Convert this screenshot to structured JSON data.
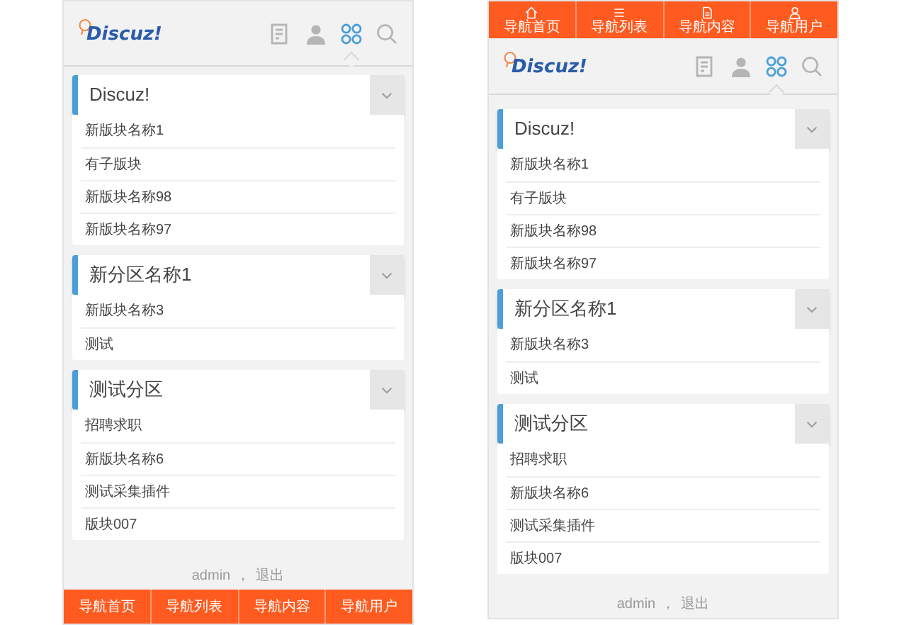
{
  "screens": [
    {
      "kind": "bottomnav",
      "logo": "Discuz!",
      "header_tabs": [
        {
          "selected": false
        },
        {
          "selected": false
        },
        {
          "selected": true
        },
        {
          "selected": false
        }
      ],
      "sections": [
        {
          "title": "Discuz!",
          "boards": [
            "新版块名称1",
            "有子版块",
            "新版块名称98",
            "新版块名称97"
          ]
        },
        {
          "title": "新分区名称1",
          "boards": [
            "新版块名称3",
            "测试"
          ]
        },
        {
          "title": "测试分区",
          "boards": [
            "招聘求职",
            "新版块名称6",
            "测试采集插件",
            "版块007"
          ]
        }
      ],
      "footer": {
        "user": "admin",
        "separator": "，",
        "logout": "退出"
      },
      "nav": [
        "导航首页",
        "导航列表",
        "导航内容",
        "导航用户"
      ]
    },
    {
      "kind": "topnav",
      "logo": "Discuz!",
      "header_tabs": [
        {
          "selected": false
        },
        {
          "selected": false
        },
        {
          "selected": true
        },
        {
          "selected": false
        }
      ],
      "sections": [
        {
          "title": "Discuz!",
          "boards": [
            "新版块名称1",
            "有子版块",
            "新版块名称98",
            "新版块名称97"
          ]
        },
        {
          "title": "新分区名称1",
          "boards": [
            "新版块名称3",
            "测试"
          ]
        },
        {
          "title": "测试分区",
          "boards": [
            "招聘求职",
            "新版块名称6",
            "测试采集插件",
            "版块007"
          ]
        }
      ],
      "footer": {
        "user": "admin",
        "separator": "，",
        "logout": "退出"
      },
      "nav": [
        "导航首页",
        "导航列表",
        "导航内容",
        "导航用户"
      ]
    }
  ]
}
